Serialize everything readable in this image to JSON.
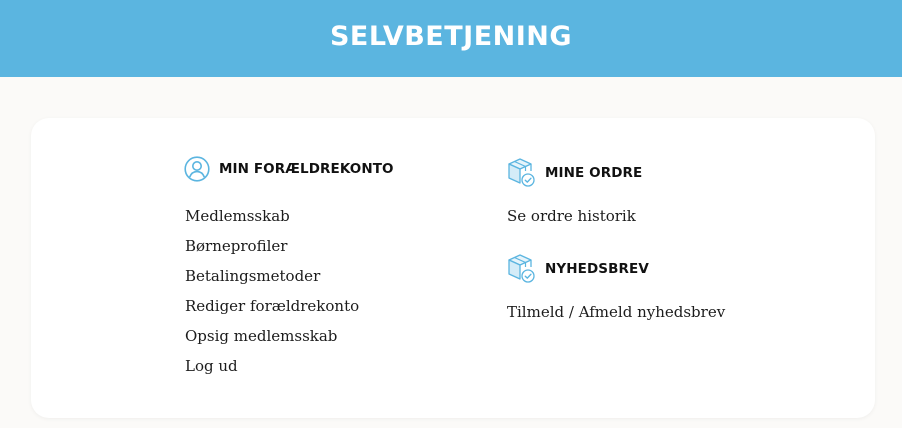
{
  "header": {
    "title": "SELVBETJENING",
    "background": "#5bb5e0"
  },
  "account": {
    "title": "MIN FORÆLDREKONTO",
    "icon": "user-circle-icon",
    "links": [
      "Medlemsskab",
      "Børneprofiler",
      "Betalingsmetoder",
      "Rediger forældrekonto",
      "Opsig medlemsskab",
      "Log ud"
    ]
  },
  "orders": {
    "title": "MINE ORDRE",
    "icon": "package-check-icon",
    "links": [
      "Se ordre historik"
    ]
  },
  "newsletter": {
    "title": "NYHEDSBREV",
    "icon": "package-check-icon",
    "links": [
      "Tilmeld / Afmeld nyhedsbrev"
    ]
  },
  "colors": {
    "accent": "#5bb5e0",
    "page_background": "#fbfaf8",
    "card_background": "#ffffff"
  }
}
